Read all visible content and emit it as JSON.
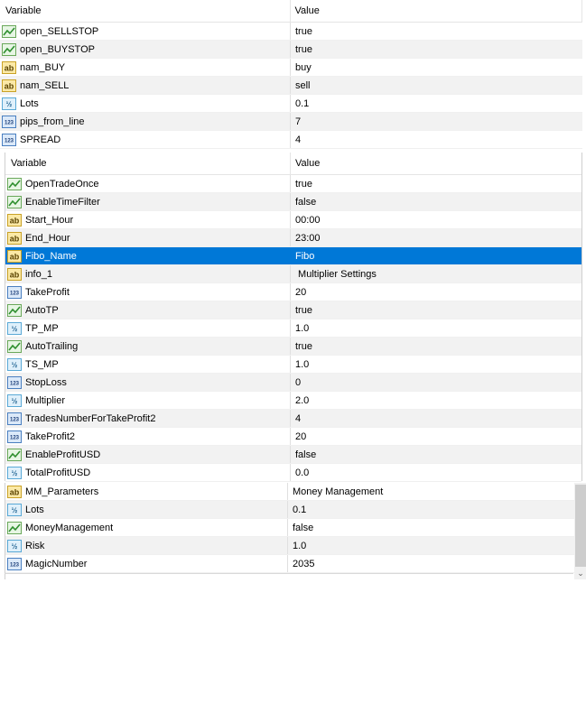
{
  "columns": {
    "variable": "Variable",
    "value": "Value"
  },
  "icons": {
    "bool": "bool-chart-icon",
    "string": "string-ab-icon",
    "double": "double-fraction-icon",
    "int": "int-123-icon"
  },
  "colors": {
    "selection": "#0078d7",
    "alt_row": "#f2f2f2"
  },
  "panel1": {
    "rows": [
      {
        "type": "bool",
        "name": "open_SELLSTOP",
        "value": "true"
      },
      {
        "type": "bool",
        "name": "open_BUYSTOP",
        "value": "true"
      },
      {
        "type": "string",
        "name": "nam_BUY",
        "value": "buy"
      },
      {
        "type": "string",
        "name": "nam_SELL",
        "value": "sell"
      },
      {
        "type": "double",
        "name": "Lots",
        "value": "0.1"
      },
      {
        "type": "int",
        "name": "pips_from_line",
        "value": "7"
      },
      {
        "type": "int",
        "name": "SPREAD",
        "value": "4"
      }
    ]
  },
  "panel2": {
    "rows": [
      {
        "type": "bool",
        "name": "OpenTradeOnce",
        "value": "true"
      },
      {
        "type": "bool",
        "name": "EnableTimeFilter",
        "value": "false"
      },
      {
        "type": "string",
        "name": "Start_Hour",
        "value": "00:00"
      },
      {
        "type": "string",
        "name": "End_Hour",
        "value": "23:00"
      },
      {
        "type": "string",
        "name": "Fibo_Name",
        "value": "Fibo",
        "selected": true
      },
      {
        "type": "string",
        "name": "info_1",
        "value": " Multiplier Settings"
      },
      {
        "type": "int",
        "name": "TakeProfit",
        "value": "20"
      },
      {
        "type": "bool",
        "name": "AutoTP",
        "value": "true"
      },
      {
        "type": "double",
        "name": "TP_MP",
        "value": "1.0"
      },
      {
        "type": "bool",
        "name": "AutoTrailing",
        "value": "true"
      },
      {
        "type": "double",
        "name": "TS_MP",
        "value": "1.0"
      },
      {
        "type": "int",
        "name": "StopLoss",
        "value": "0"
      },
      {
        "type": "double",
        "name": "Multiplier",
        "value": "2.0"
      },
      {
        "type": "int",
        "name": "TradesNumberForTakeProfit2",
        "value": "4"
      },
      {
        "type": "int",
        "name": "TakeProfit2",
        "value": "20"
      },
      {
        "type": "bool",
        "name": "EnableProfitUSD",
        "value": "false"
      },
      {
        "type": "double",
        "name": "TotalProfitUSD",
        "value": "0.0"
      }
    ]
  },
  "panel3": {
    "rows": [
      {
        "type": "string",
        "name": "MM_Parameters",
        "value": "Money Management"
      },
      {
        "type": "double",
        "name": "Lots",
        "value": "0.1"
      },
      {
        "type": "bool",
        "name": "MoneyManagement",
        "value": "false"
      },
      {
        "type": "double",
        "name": "Risk",
        "value": "1.0"
      },
      {
        "type": "int",
        "name": "MagicNumber",
        "value": "2035"
      }
    ]
  }
}
